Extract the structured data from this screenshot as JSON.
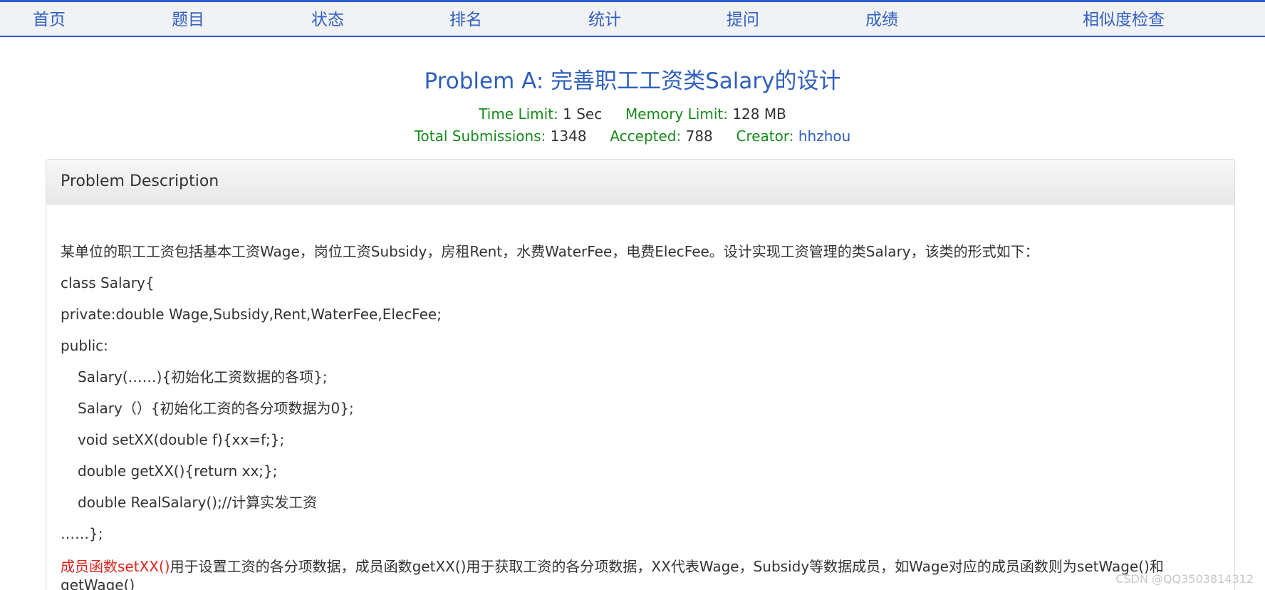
{
  "nav": {
    "items": [
      "首页",
      "题目",
      "状态",
      "排名",
      "统计",
      "提问",
      "成绩",
      "相似度检查"
    ]
  },
  "problem": {
    "title": "Problem A: 完善职工工资类Salary的设计",
    "time_limit_label": "Time Limit:",
    "time_limit_value": "1 Sec",
    "memory_limit_label": "Memory Limit:",
    "memory_limit_value": "128 MB",
    "total_submissions_label": "Total Submissions:",
    "total_submissions_value": "1348",
    "accepted_label": "Accepted:",
    "accepted_value": "788",
    "creator_label": "Creator:",
    "creator_value": "hhzhou"
  },
  "description": {
    "heading": "Problem Description",
    "lines": [
      "某单位的职工工资包括基本工资Wage，岗位工资Subsidy，房租Rent，水费WaterFee，电费ElecFee。设计实现工资管理的类Salary，该类的形式如下：",
      "class Salary{",
      "private:double Wage,Subsidy,Rent,WaterFee,ElecFee;",
      "public:",
      "Salary(……){初始化工资数据的各项};",
      "Salary（）{初始化工资的各分项数据为0};",
      "void setXX(double f){xx=f;};",
      "double getXX(){return xx;};",
      "double RealSalary();//计算实发工资",
      "……};"
    ],
    "last_line_red": "成员函数setXX()",
    "last_line_rest": "用于设置工资的各分项数据，成员函数getXX()用于获取工资的各分项数据，XX代表Wage，Subsidy等数据成员，如Wage对应的成员函数则为setWage()和",
    "last_line_wrap": "getWage()"
  },
  "watermark": "CSDN @QQ3503814312",
  "colors": {
    "nav_link": "#2f5fbf",
    "label_green": "#198a1c",
    "highlight_red": "#e0261d",
    "nav_border": "#2f5fd0"
  }
}
